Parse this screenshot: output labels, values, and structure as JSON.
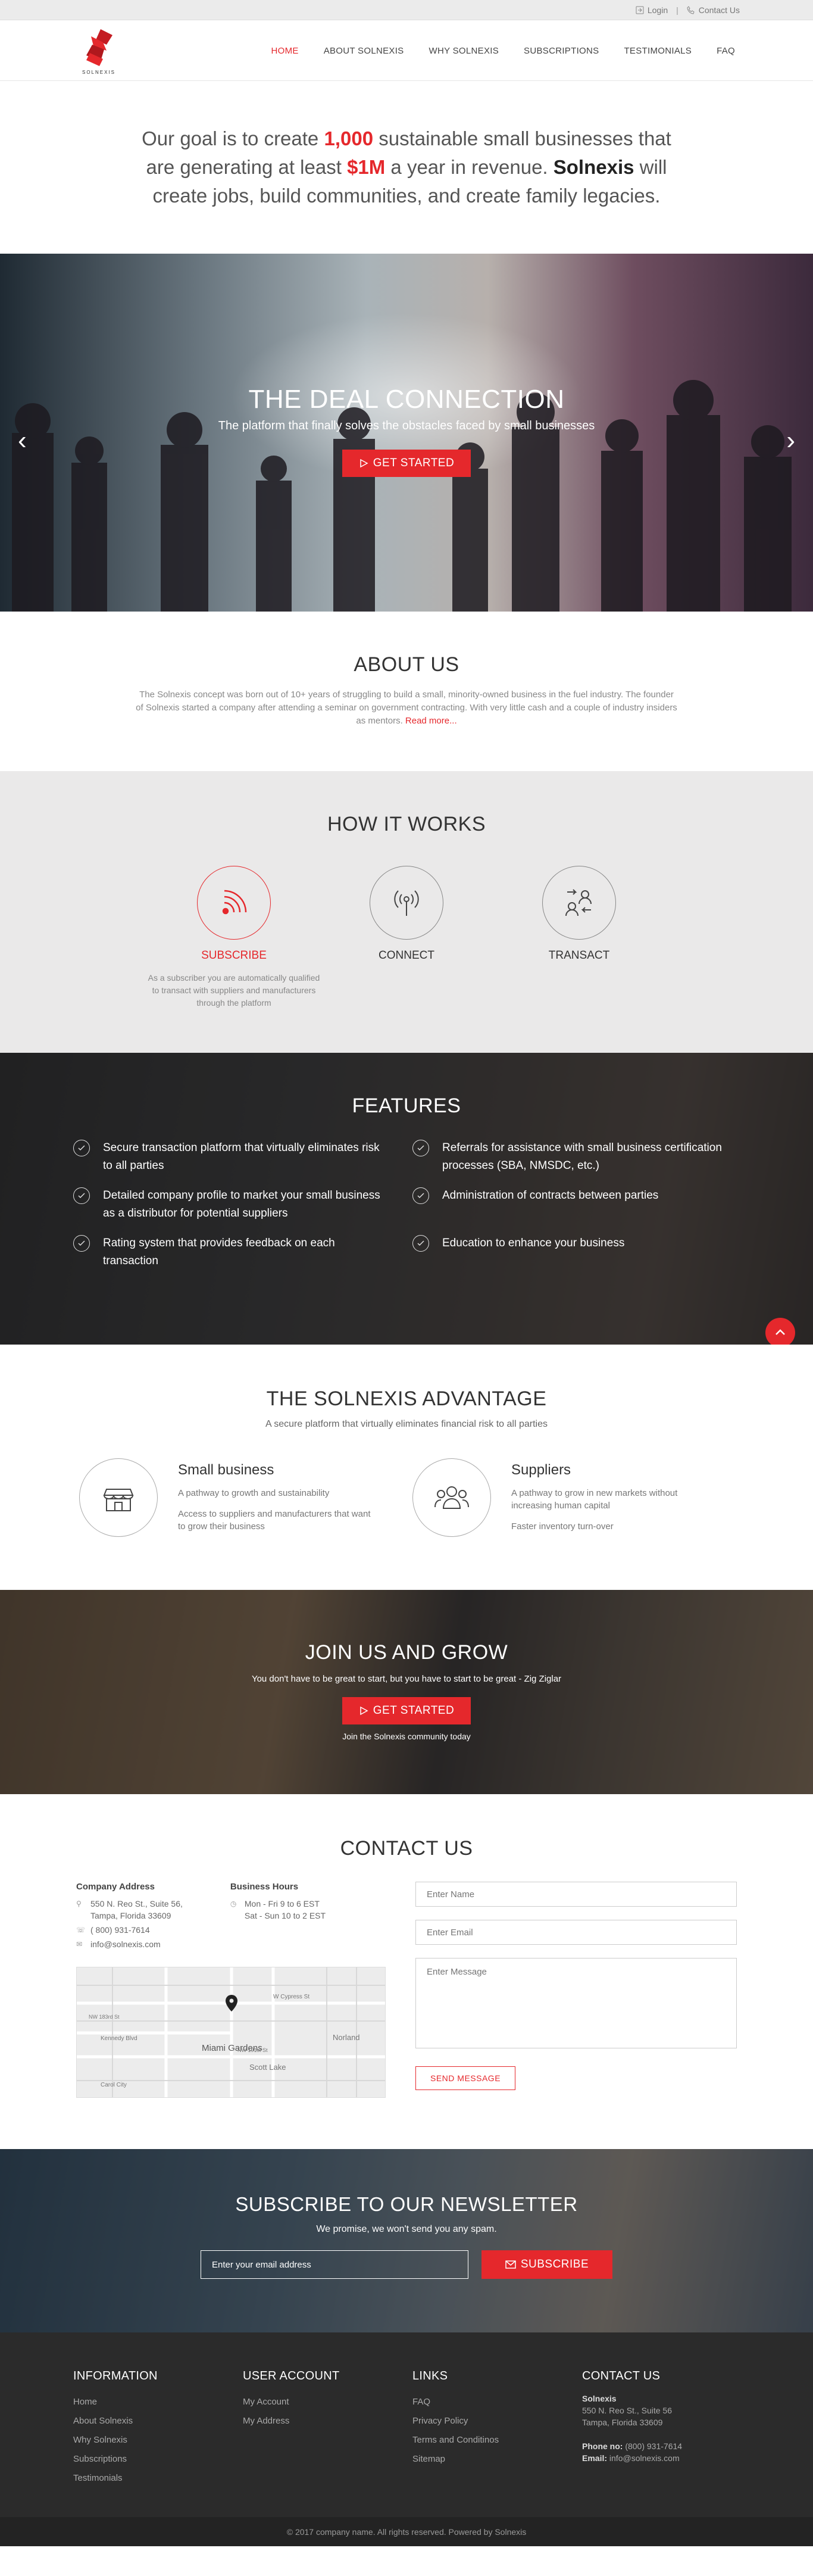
{
  "topbar": {
    "login": "Login",
    "separator": "|",
    "contact": "Contact Us"
  },
  "brand": {
    "name": "SOLNEXIS",
    "accent": "#e5282c"
  },
  "nav": [
    {
      "label": "HOME",
      "active": true
    },
    {
      "label": "ABOUT SOLNEXIS"
    },
    {
      "label": "WHY SOLNEXIS"
    },
    {
      "label": "SUBSCRIPTIONS"
    },
    {
      "label": "TESTIMONIALS"
    },
    {
      "label": "FAQ"
    }
  ],
  "goal": {
    "p1": "Our goal is to create ",
    "n1": "1,000",
    "p2": " sustainable small businesses that are generating at least ",
    "n2": "$1M",
    "p3": " a year in revenue. ",
    "brand": "Solnexis",
    "p4": " will create jobs, build communities, and create family legacies."
  },
  "hero": {
    "title": "THE DEAL CONNECTION",
    "subtitle": "The platform that finally solves the obstacles faced by small businesses",
    "button": "GET STARTED",
    "prev_icon": "chevron-left-icon",
    "next_icon": "chevron-right-icon"
  },
  "about": {
    "title": "ABOUT US",
    "text": "The Solnexis concept was born out of 10+ years of struggling to build a small, minority-owned business in the fuel industry. The founder of Solnexis started a company after attending a seminar on government contracting.  With very little cash and a couple of industry insiders as mentors. ",
    "read_more": "Read more..."
  },
  "how": {
    "title": "HOW IT WORKS",
    "steps": [
      {
        "label": "SUBSCRIBE",
        "icon": "signal-icon",
        "desc": "As a subscriber you are automatically qualified to transact with suppliers and manufacturers through the platform"
      },
      {
        "label": "CONNECT",
        "icon": "antenna-icon",
        "desc": ""
      },
      {
        "label": "TRANSACT",
        "icon": "exchange-users-icon",
        "desc": ""
      }
    ]
  },
  "features": {
    "title": "FEATURES",
    "items": [
      "Secure transaction platform that virtually eliminates risk to all parties",
      "Referrals for assistance with small business certification processes (SBA, NMSDC, etc.)",
      "Detailed company profile to market your small business as a distributor for potential suppliers",
      "Administration of contracts between parties",
      "Rating system that provides feedback on each transaction",
      "Education to enhance your business"
    ]
  },
  "advantage": {
    "title": "THE SOLNEXIS ADVANTAGE",
    "lead": "A secure platform that virtually eliminates financial risk to all parties",
    "items": [
      {
        "title": "Small business",
        "icon": "storefront-icon",
        "p1": "A pathway to growth and sustainability",
        "p2": "Access to suppliers and manufacturers that want to grow their business"
      },
      {
        "title": "Suppliers",
        "icon": "group-icon",
        "p1": "A pathway to grow in new markets without increasing human capital",
        "p2": "Faster inventory turn-over"
      }
    ]
  },
  "join": {
    "title": "JOIN US AND GROW",
    "quote": "You don't have to be great to start, but you have to start to be great - Zig Ziglar",
    "button": "GET STARTED",
    "community": "Join the Solnexis community today"
  },
  "contact": {
    "title": "CONTACT US",
    "address_title": "Company Address",
    "address1": "550 N. Reo St., Suite 56,",
    "address2": "Tampa, Florida 33609",
    "phone": "( 800) 931-7614",
    "email": "info@solnexis.com",
    "hours_title": "Business Hours",
    "hours1": "Mon - Fri    9 to 6 EST",
    "hours2": "Sat - Sun   10 to 2 EST",
    "map_labels": [
      "W Cypress St",
      "Kennedy Blvd",
      "Miami Gardens",
      "Norland",
      "Scott Lake",
      "NW 191st St",
      "NW 183rd St",
      "Carol City"
    ],
    "name_placeholder": "Enter Name",
    "email_placeholder": "Enter Email",
    "message_placeholder": "Enter Message",
    "send": "SEND MESSAGE"
  },
  "newsletter": {
    "title": "SUBSCRIBE TO OUR NEWSLETTER",
    "promise": "We promise, we won't send you any spam.",
    "placeholder": "Enter your email address",
    "button": "SUBSCRIBE"
  },
  "footer": {
    "info_title": "INFORMATION",
    "info_links": [
      "Home",
      "About Solnexis",
      "Why Solnexis",
      "Subscriptions",
      "Testimonials"
    ],
    "account_title": "USER ACCOUNT",
    "account_links": [
      "My Account",
      "My Address"
    ],
    "links_title": "LINKS",
    "links": [
      "FAQ",
      "Privacy Policy",
      "Terms and Conditinos",
      "Sitemap"
    ],
    "contact_title": "CONTACT US",
    "company": "Solnexis",
    "addr1": "550 N. Reo St., Suite 56",
    "addr2": "Tampa, Florida 33609",
    "phone_label": "Phone no:",
    "phone": " (800) 931-7614",
    "email_label": "Email:",
    "email": " info@solnexis.com",
    "copyright": "© 2017 company name. All rights reserved. Powered by Solnexis"
  }
}
